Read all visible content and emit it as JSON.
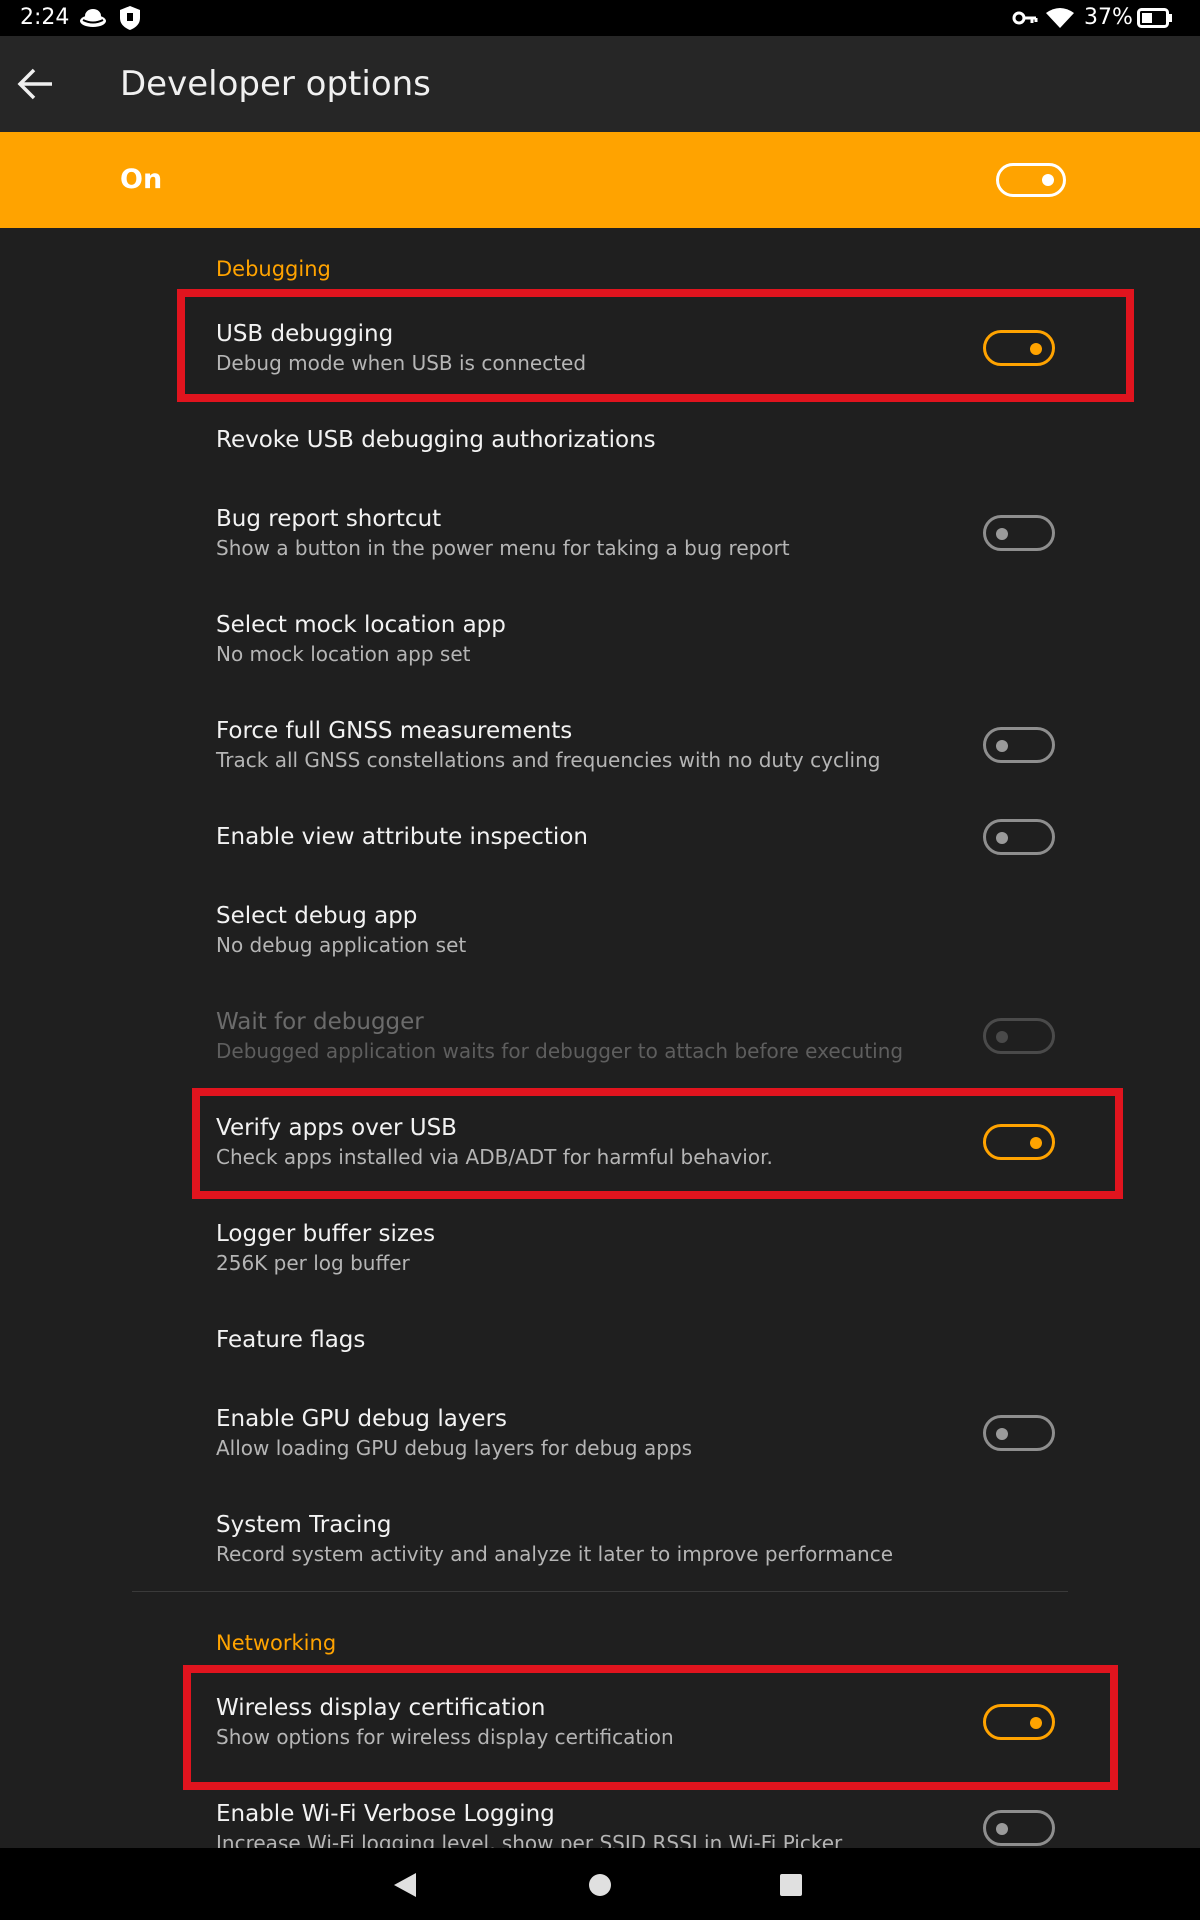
{
  "status_bar": {
    "time": "2:24",
    "battery": "37%"
  },
  "app_bar": {
    "title": "Developer options"
  },
  "master": {
    "label": "On",
    "enabled": true
  },
  "sections": {
    "debugging": "Debugging",
    "networking": "Networking"
  },
  "items": [
    {
      "title": "USB debugging",
      "summary": "Debug mode when USB is connected",
      "toggle": "on"
    },
    {
      "title": "Revoke USB debugging authorizations",
      "summary": "",
      "toggle": "none"
    },
    {
      "title": "Bug report shortcut",
      "summary": "Show a button in the power menu for taking a bug report",
      "toggle": "off"
    },
    {
      "title": "Select mock location app",
      "summary": "No mock location app set",
      "toggle": "none"
    },
    {
      "title": "Force full GNSS measurements",
      "summary": "Track all GNSS constellations and frequencies with no duty cycling",
      "toggle": "off"
    },
    {
      "title": "Enable view attribute inspection",
      "summary": "",
      "toggle": "off"
    },
    {
      "title": "Select debug app",
      "summary": "No debug application set",
      "toggle": "none"
    },
    {
      "title": "Wait for debugger",
      "summary": "Debugged application waits for debugger to attach before executing",
      "toggle": "disabled"
    },
    {
      "title": "Verify apps over USB",
      "summary": "Check apps installed via ADB/ADT for harmful behavior.",
      "toggle": "on"
    },
    {
      "title": "Logger buffer sizes",
      "summary": "256K per log buffer",
      "toggle": "none"
    },
    {
      "title": "Feature flags",
      "summary": "",
      "toggle": "none"
    },
    {
      "title": "Enable GPU debug layers",
      "summary": "Allow loading GPU debug layers for debug apps",
      "toggle": "off"
    },
    {
      "title": "System Tracing",
      "summary": "Record system activity and analyze it later to improve performance",
      "toggle": "none"
    },
    {
      "title": "Wireless display certification",
      "summary": "Show options for wireless display certification",
      "toggle": "on"
    },
    {
      "title": "Enable Wi-Fi Verbose Logging",
      "summary": "Increase Wi-Fi logging level, show per SSID RSSI in Wi-Fi Picker",
      "toggle": "off"
    }
  ],
  "colors": {
    "accent": "#ffa300",
    "background": "#1f1f1f",
    "highlight": "#e0141e"
  },
  "icons": {
    "back": "arrow-left-icon",
    "nav_back": "triangle-back-icon",
    "nav_home": "circle-home-icon",
    "nav_recents": "square-recents-icon"
  }
}
